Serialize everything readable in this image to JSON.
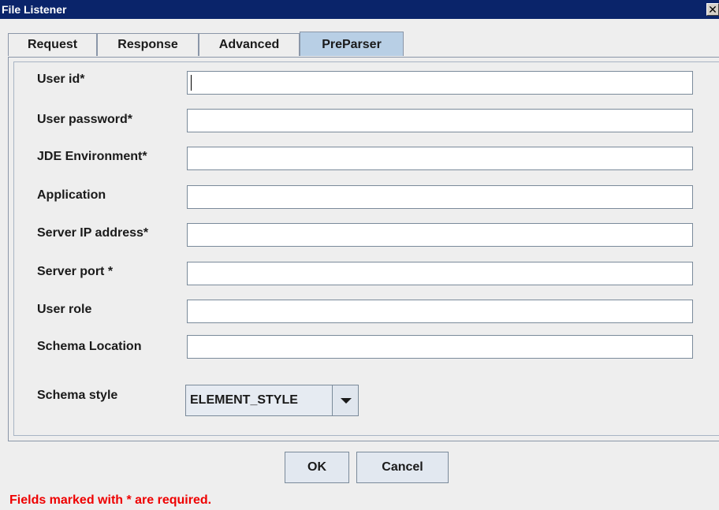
{
  "window": {
    "title": "File Listener",
    "close_glyph": "✕"
  },
  "tabs": [
    {
      "label": "Request",
      "active": false
    },
    {
      "label": "Response",
      "active": false
    },
    {
      "label": "Advanced",
      "active": false
    },
    {
      "label": "PreParser",
      "active": true
    }
  ],
  "form": {
    "fields": [
      {
        "label": "User id*",
        "value": ""
      },
      {
        "label": "User password*",
        "value": ""
      },
      {
        "label": "JDE Environment*",
        "value": ""
      },
      {
        "label": "Application",
        "value": ""
      },
      {
        "label": "Server IP address*",
        "value": ""
      },
      {
        "label": "Server port *",
        "value": ""
      },
      {
        "label": "User role",
        "value": ""
      },
      {
        "label": "Schema Location",
        "value": ""
      }
    ],
    "schema_style": {
      "label": "Schema style",
      "selected": "ELEMENT_STYLE"
    }
  },
  "buttons": {
    "ok": "OK",
    "cancel": "Cancel"
  },
  "footer": {
    "note": "Fields marked with * are required."
  },
  "colors": {
    "titlebar": "#0a246a",
    "active_tab": "#b8cfe5",
    "required_note": "#ee0000"
  }
}
